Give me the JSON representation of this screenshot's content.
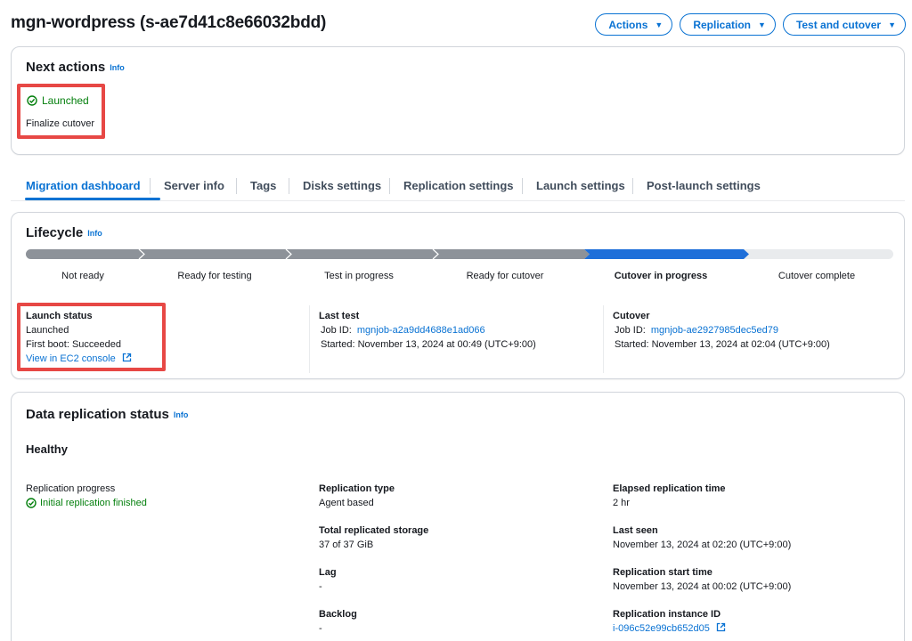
{
  "header": {
    "title": "mgn-wordpress (s-ae7d41c8e66032bdd)",
    "buttons": [
      "Actions",
      "Replication",
      "Test and cutover"
    ]
  },
  "next_actions": {
    "title": "Next actions",
    "info": "Info",
    "status": "Launched",
    "action": "Finalize cutover"
  },
  "tabs": [
    "Migration dashboard",
    "Server info",
    "Tags",
    "Disks settings",
    "Replication settings",
    "Launch settings",
    "Post-launch settings"
  ],
  "lifecycle": {
    "title": "Lifecycle",
    "info": "Info",
    "stages": [
      "Not ready",
      "Ready for testing",
      "Test in progress",
      "Ready for cutover",
      "Cutover in progress",
      "Cutover complete"
    ],
    "current_stage": "Cutover in progress",
    "launch_status": {
      "label": "Launch status",
      "value": "Launched",
      "first_boot": "First boot: Succeeded",
      "link": "View in EC2 console"
    },
    "last_test": {
      "label": "Last test",
      "job_label": "Job ID:",
      "job_id": "mgnjob-a2a9dd4688e1ad066",
      "started": "Started: November 13, 2024 at 00:49 (UTC+9:00)"
    },
    "cutover": {
      "label": "Cutover",
      "job_label": "Job ID:",
      "job_id": "mgnjob-ae2927985dec5ed79",
      "started": "Started: November 13, 2024 at 02:04 (UTC+9:00)"
    }
  },
  "replication": {
    "title": "Data replication status",
    "info": "Info",
    "health": "Healthy",
    "progress_label": "Replication progress",
    "progress_value": "Initial replication finished",
    "type_label": "Replication type",
    "type_value": "Agent based",
    "storage_label": "Total replicated storage",
    "storage_value": "37 of 37 GiB",
    "lag_label": "Lag",
    "lag_value": "-",
    "backlog_label": "Backlog",
    "backlog_value": "-",
    "elapsed_label": "Elapsed replication time",
    "elapsed_value": "2 hr",
    "last_seen_label": "Last seen",
    "last_seen_value": "November 13, 2024 at 02:20 (UTC+9:00)",
    "start_label": "Replication start time",
    "start_value": "November 13, 2024 at 00:02 (UTC+9:00)",
    "instance_label": "Replication instance ID",
    "instance_value": "i-096c52e99cb652d05"
  },
  "colors": {
    "accent": "#0972d3",
    "success": "#037f0c",
    "highlight": "#e74845",
    "stage_done": "#8d9299",
    "stage_pending": "#e9ebed"
  }
}
